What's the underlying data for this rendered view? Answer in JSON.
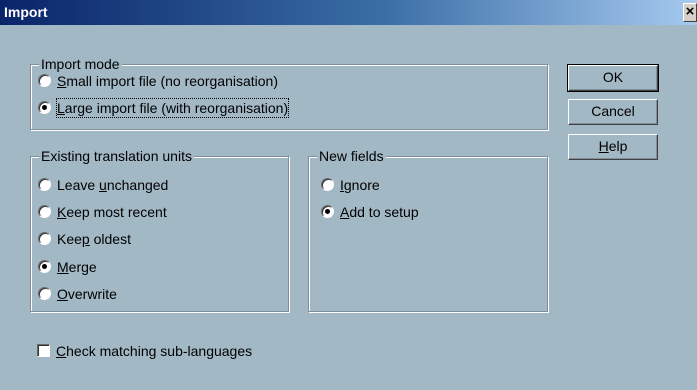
{
  "window": {
    "title": "Import",
    "close_glyph": "×"
  },
  "import_mode": {
    "legend": "Import mode",
    "small": {
      "pre": "",
      "ul": "S",
      "post": "mall import file (no reorganisation)",
      "selected": false
    },
    "large": {
      "pre": "",
      "ul": "L",
      "post": "arge import file (with reorganisation)",
      "selected": true
    }
  },
  "existing_units": {
    "legend": "Existing translation units",
    "options": [
      {
        "pre": "Leave ",
        "ul": "u",
        "post": "nchanged",
        "selected": false
      },
      {
        "pre": "",
        "ul": "K",
        "post": "eep most recent",
        "selected": false
      },
      {
        "pre": "Kee",
        "ul": "p",
        "post": " oldest",
        "selected": false
      },
      {
        "pre": "",
        "ul": "M",
        "post": "erge",
        "selected": true
      },
      {
        "pre": "",
        "ul": "O",
        "post": "verwrite",
        "selected": false
      }
    ]
  },
  "new_fields": {
    "legend": "New fields",
    "options": [
      {
        "pre": "",
        "ul": "I",
        "post": "gnore",
        "selected": false
      },
      {
        "pre": "",
        "ul": "A",
        "post": "dd to setup",
        "selected": true
      }
    ]
  },
  "check_sub_languages": {
    "pre": "",
    "ul": "C",
    "post": "heck matching sub-languages",
    "checked": false
  },
  "buttons": {
    "ok": {
      "label": "OK"
    },
    "cancel": {
      "label": "Cancel"
    },
    "help": {
      "pre": "",
      "ul": "H",
      "post": "elp"
    }
  },
  "colors": {
    "face": "#a3b8c5",
    "title_start": "#0a246a",
    "title_end": "#a6caf0"
  }
}
